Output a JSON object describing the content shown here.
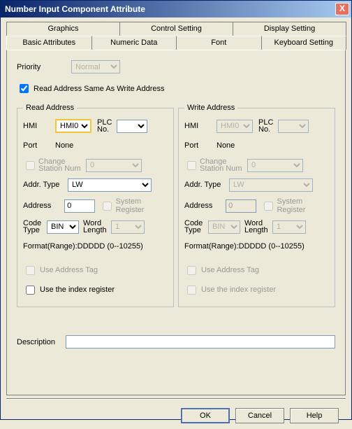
{
  "window": {
    "title": "Number Input Component Attribute",
    "close_icon": "X"
  },
  "tabs_row1": [
    "Graphics",
    "Control Setting",
    "Display Setting"
  ],
  "tabs_row2": [
    "Basic Attributes",
    "Numeric Data",
    "Font",
    "Keyboard Setting"
  ],
  "tabs_active": "Basic Attributes",
  "priority": {
    "label": "Priority",
    "value": "Normal"
  },
  "same_addr": {
    "label": "Read Address Same As Write Address",
    "checked": true
  },
  "groups": {
    "read": "Read Address",
    "write": "Write Address"
  },
  "labels": {
    "hmi": "HMI",
    "plc_no": "PLC No.",
    "port": "Port",
    "port_val": "None",
    "change_station": "Change Station Num",
    "addr_type": "Addr. Type",
    "address": "Address",
    "system_register": "System Register",
    "code_type": "Code Type",
    "word_length": "Word Length",
    "format": "Format(Range):DDDDD (0--10255)",
    "use_addr_tag": "Use Address Tag",
    "use_index_reg": "Use the index register",
    "description": "Description"
  },
  "read": {
    "hmi": "HMI0",
    "plc_no": "",
    "change_station_num": "0",
    "addr_type": "LW",
    "address": "0",
    "code_type": "BIN",
    "word_length": "1"
  },
  "write": {
    "hmi": "HMI0",
    "plc_no": "",
    "change_station_num": "0",
    "addr_type": "LW",
    "address": "0",
    "code_type": "BIN",
    "word_length": "1"
  },
  "buttons": {
    "ok": "OK",
    "cancel": "Cancel",
    "help": "Help"
  },
  "description_value": ""
}
